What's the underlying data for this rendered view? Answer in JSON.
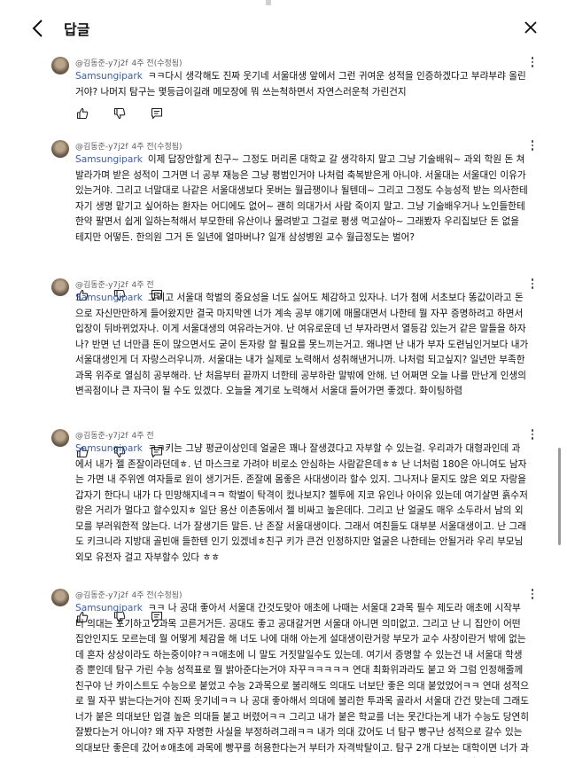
{
  "header": {
    "title": "답글"
  },
  "replies": [
    {
      "author": "@김동준-y7j2f",
      "time": "4주 전(수정됨)",
      "mention": "Samsungipark",
      "text": "ㅋㅋ다시 생각해도 진짜 웃기네 서울대생 앞에서 그런 귀여운 성적을 인증하겠다고 부랴부랴 올린거야? 나머지 탐구는 몇등급이길래 메모장에 뭐 쓰는척하면서 자연스러운척 가린건지"
    },
    {
      "author": "@김동준-y7j2f",
      "time": "4주 전(수정됨)",
      "mention": "Samsungipark",
      "text": "이제 답장안할게 친구~ 그정도 머리론 대학교 갈 생각하지 말고 그냥 기술배워~ 과외 학원 돈 쳐발라가며 받은 성적이 그거면 너 공부 재능은 그냥 평범인거야 나처럼 축복받은게 아니야. 서울대는 서울대인 이유가 있는거야. 그리고 너말대로 나같은 서울대생보다 못버는 월급쟁이나 될텐데~ 그리고 그정도 수능성적 받는 의사한테 자기 생명 맡기고 싶어하는 환자는 어디에도 없어~ 괜히 의대가서 사람 죽이지 말고. 그냥 기술배우거나 노인들한테 한약 팔면서 쉽게 일하는척해서 부모한테 유산이나 물려받고 그걸로 평생 먹고살아~ 그래봤자 우리집보단 돈 없을 테지만 어떻든. 한의원 그거 돈 일년에 얼마버냐? 일개 삼성병원 교수 월급정도는 벌어?"
    },
    {
      "author": "@김동준-y7j2f",
      "time": "4주 전",
      "mention": "Samsungipark",
      "text": "그리고 서울대 학벌의 중요성을 너도 싫어도 체감하고 있자나. 너가 첨에 서초보다 똥값이라고 돈으로 자신만만하게 들어왔지만 결국 마지막엔 너가 계속 공부 얘기에 매몰대면서 나한테 뭘 자꾸 증명하려고 하면서 입장이 뒤바뀌었자나. 이게 서울대생의 여유라는거야. 난 여유로운데 넌 부자라면서 열등감 있는거 같은 말들을 하자나? 반면 넌 너만큼 돈이 많으면서도 굳이 돈자랑 할 필요를 못느끼는거고. 왜냐면 난 내가 부자 도련님인거보다 내가 서울대생인게 더 자랑스러우니까. 서울대는 내가 실제로 노력해서 성취해낸거니까. 나처럼 되고싶지? 일년만 부족한 과목 위주로 열심히 공부해라. 난 처음부터 끝까지 너한테 공부하란 말밖에 안해. 넌 어쩌면 오늘 나를 만난게 인생의 변곡점이나 큰 자극이 될 수도 있겠다. 오늘을 계기로 노력해서 서울대 들어가면 좋겠다. 화이팅하렴"
    },
    {
      "author": "@김동준-y7j2f",
      "time": "4주 전",
      "mention": "Samsungipark",
      "text": "ㅋㅋ키는 그냥 평균이상인데     얼굴은 꽤나 잘생겼다고 자부할 수 있는걸. 우리과가 대형과인데 과에서 내가 젤 존잘이라던데ㅎ. 넌 마스크로 가려야 비로소 안심하는 사람같은데ㅎㅎ 난 너처럼 180은 아니여도 남자는 가면 내 주위엔 여자들로 원이 생기거든. 존잘에 몸좋은 사대생이라 할수 있지. 그나저나 묻지도 않은 외모 자랑을 갑자기 한다니 내가 다 민망해지네ㅋㅋ 학벌이 탁격이 컸나보지? 첼투에 지코 유인나 아이유 있는데 여기살면 흙수저랑은 거리가 멀다고 할수있지ㅎ 일단 용산 이촌동에서 젤 비싸고 높은데다. 그리고 난 얼굴도 매우 소두라서 남의 외모를 부러워한적 않는다. 너가 잘생기든 말든. 난 존잘 서울대생이다. 그래서 여친들도 대부분 서울대생이고. 난 그래도 키크니라 지방대 골빈애 들한텐 인기 있겠네ㅎ친구 키가 큰건 인정하지만 얼굴은 나한테는 안될거라 우리 부모님 외모 유전자 걸고 자부할수 있다 ㅎㅎ"
    },
    {
      "author": "@김동준-y7j2f",
      "time": "4주 전(수정됨)",
      "mention": "Samsungipark",
      "text": "ㅋㅋ 나 공대 좋아서 서울대 간것도맞아 애초에 나때는 서울대 2과목 필수 제도라 애초에 시작부터 의대는 포기하고 2과목 고른거거든. 공대도 좋고 공대갈거면 서울대 아니면 의미없고. 그리고 난 니 집안이 어떤집안인지도 모르는데 뭘 어떻게 체감을 해 너도 나에 대해 아는게 설대생이란거랑 부모가 교수 사장이란거 밖에 없는데 혼자 상상이라도 하는중이야?ㅋㅋ애초에 니 말도 거짓말일수도 있는데. 여기서 증명할 수 있는건 내 서울대 학생증 뿐인데 탐구 가린 수능 성적표로 뭘 밝아준다는거야 자꾸ㅋㅋㅋㅋㅋ 연대 최화위과라도 붙고 와 그럼 인정해줄께 친구야 난 카이스트도 수능으로 붙었고 수능 2과목으로 불리해도 의대도 너보단 좋은 의대 붙었었어ㅋㅋ 연대 성적으로 뭘 자꾸 밝는다는거야 진짜 웃기네ㅋㅋ 나 공대 좋아해서 의대에 불리한 투과목 골라서 서울대 간건 맞는데 그래도 너가 붙은 의대보단 입결 높은 의대들 붙고 버렸어ㅋㅋ 그리고 내가 붙은 학교를 너는 못간다는게 내가 수능도 당연히 잘봤다는거 아니야? 왜 자꾸 자명한 사실을 부정하려그래ㅋㅋ 내가 의대 갔어도 너 탐구 빵구난 성적으로 갈수 있는 의대보단 좋은데 갔어ㅎ애초에 과목에 빵꾸를 허용한다는거 부터가 자격박탈이고. 탐구 2개 다보는 대학이면 너가 과연 인서울은 할수 있을까? 그리고 자꾸 돈에 집착하고 자랑하고싶어하는게 나같은 알부자는 아니고 신흥부자같은데ㅋㅋ 정말 돈 많은거 맞아? 친구집에서 적은 영상"
    }
  ]
}
